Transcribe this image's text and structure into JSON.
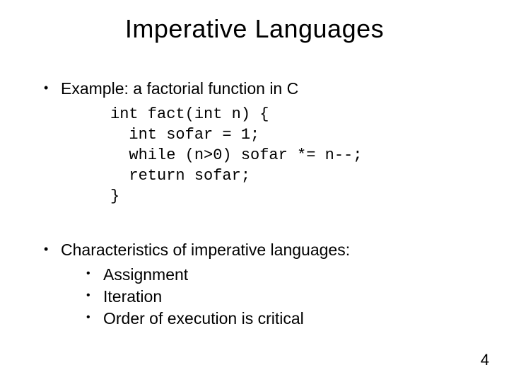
{
  "title": "Imperative Languages",
  "bullets": {
    "b1": "Example: a factorial function in C",
    "b2": "Characteristics of imperative languages:"
  },
  "code": "int fact(int n) {\n  int sofar = 1;\n  while (n>0) sofar *= n--;\n  return sofar;\n}",
  "sub": {
    "s1": "Assignment",
    "s2": "Iteration",
    "s3": "Order of execution is critical"
  },
  "page": "4"
}
